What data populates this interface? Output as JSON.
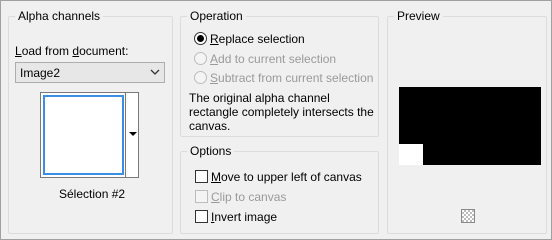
{
  "alpha_channels": {
    "title": "Alpha channels",
    "load_from_label_prefix": "",
    "load_from_label_u": "L",
    "load_from_label_rest": "oad from ",
    "load_from_label_u2": "d",
    "load_from_label_rest2": "ocument:",
    "document_value": "Image2",
    "selection_name": "Sélection #2"
  },
  "operation": {
    "title": "Operation",
    "options": [
      {
        "u": "R",
        "rest": "eplace selection",
        "checked": true,
        "enabled": true
      },
      {
        "u": "A",
        "rest": "dd to current selection",
        "checked": false,
        "enabled": false
      },
      {
        "u": "S",
        "rest": "ubtract from current selection",
        "checked": false,
        "enabled": false
      }
    ],
    "info": "The original alpha channel rectangle completely intersects the canvas."
  },
  "options": {
    "title": "Options",
    "items": [
      {
        "u": "M",
        "rest": "ove to upper left of canvas",
        "checked": false,
        "enabled": true
      },
      {
        "u": "C",
        "rest": "lip to canvas",
        "checked": false,
        "enabled": false
      },
      {
        "u": "I",
        "rest": "nvert image",
        "checked": false,
        "enabled": true
      }
    ]
  },
  "preview": {
    "title": "Preview"
  },
  "colors": {
    "swatch_border": "#3a8ee6",
    "disabled_text": "#9a9a9a",
    "preview_bg": "#000000"
  },
  "icons": {
    "dropdown": "chevron-down-icon",
    "transparency": "checkerboard-icon"
  }
}
